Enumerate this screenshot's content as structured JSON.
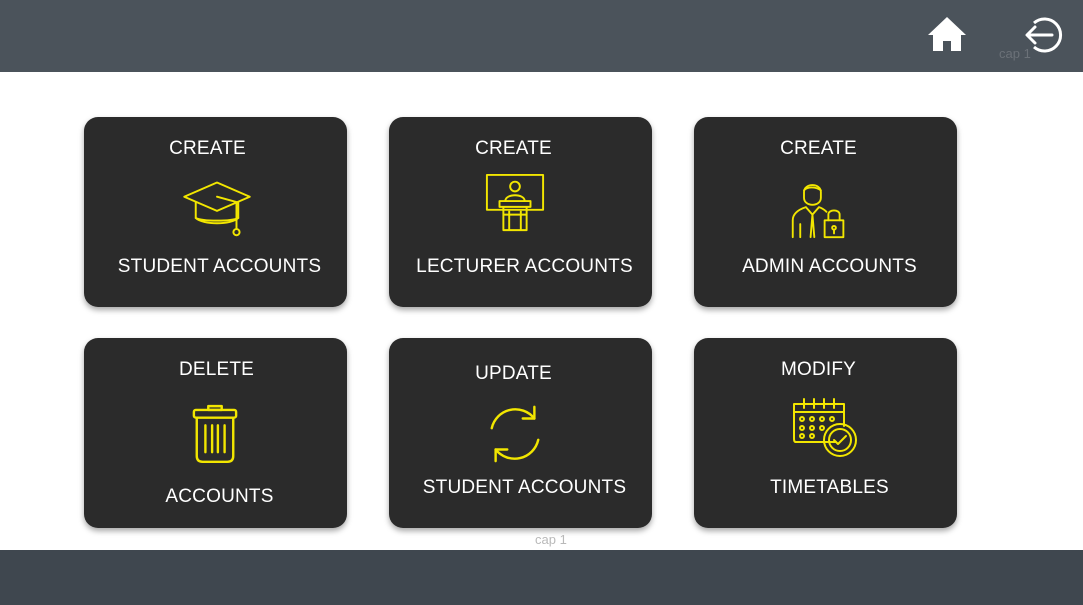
{
  "header": {
    "home_icon": "home-icon",
    "logout_icon": "logout-arrow-circle-icon",
    "cap_label": "cap 1",
    "background": "#4b535b"
  },
  "footer": {
    "cap_label": "cap 1",
    "background": "#3f474f"
  },
  "cards": [
    {
      "top": "CREATE",
      "bottom": "STUDENT ACCOUNTS",
      "icon": "graduation-cap-icon"
    },
    {
      "top": "CREATE",
      "bottom": "LECTURER ACCOUNTS",
      "icon": "lecturer-podium-icon"
    },
    {
      "top": "CREATE",
      "bottom": "ADMIN ACCOUNTS",
      "icon": "admin-lock-icon"
    },
    {
      "top": "DELETE",
      "bottom": "ACCOUNTS",
      "icon": "trash-icon"
    },
    {
      "top": "UPDATE",
      "bottom": "STUDENT ACCOUNTS",
      "icon": "refresh-icon"
    },
    {
      "top": "MODIFY",
      "bottom": "TIMETABLES",
      "icon": "calendar-clock-icon"
    }
  ],
  "colors": {
    "card_bg": "#2b2b2b",
    "icon_accent": "#f2e600",
    "text": "#ffffff"
  }
}
